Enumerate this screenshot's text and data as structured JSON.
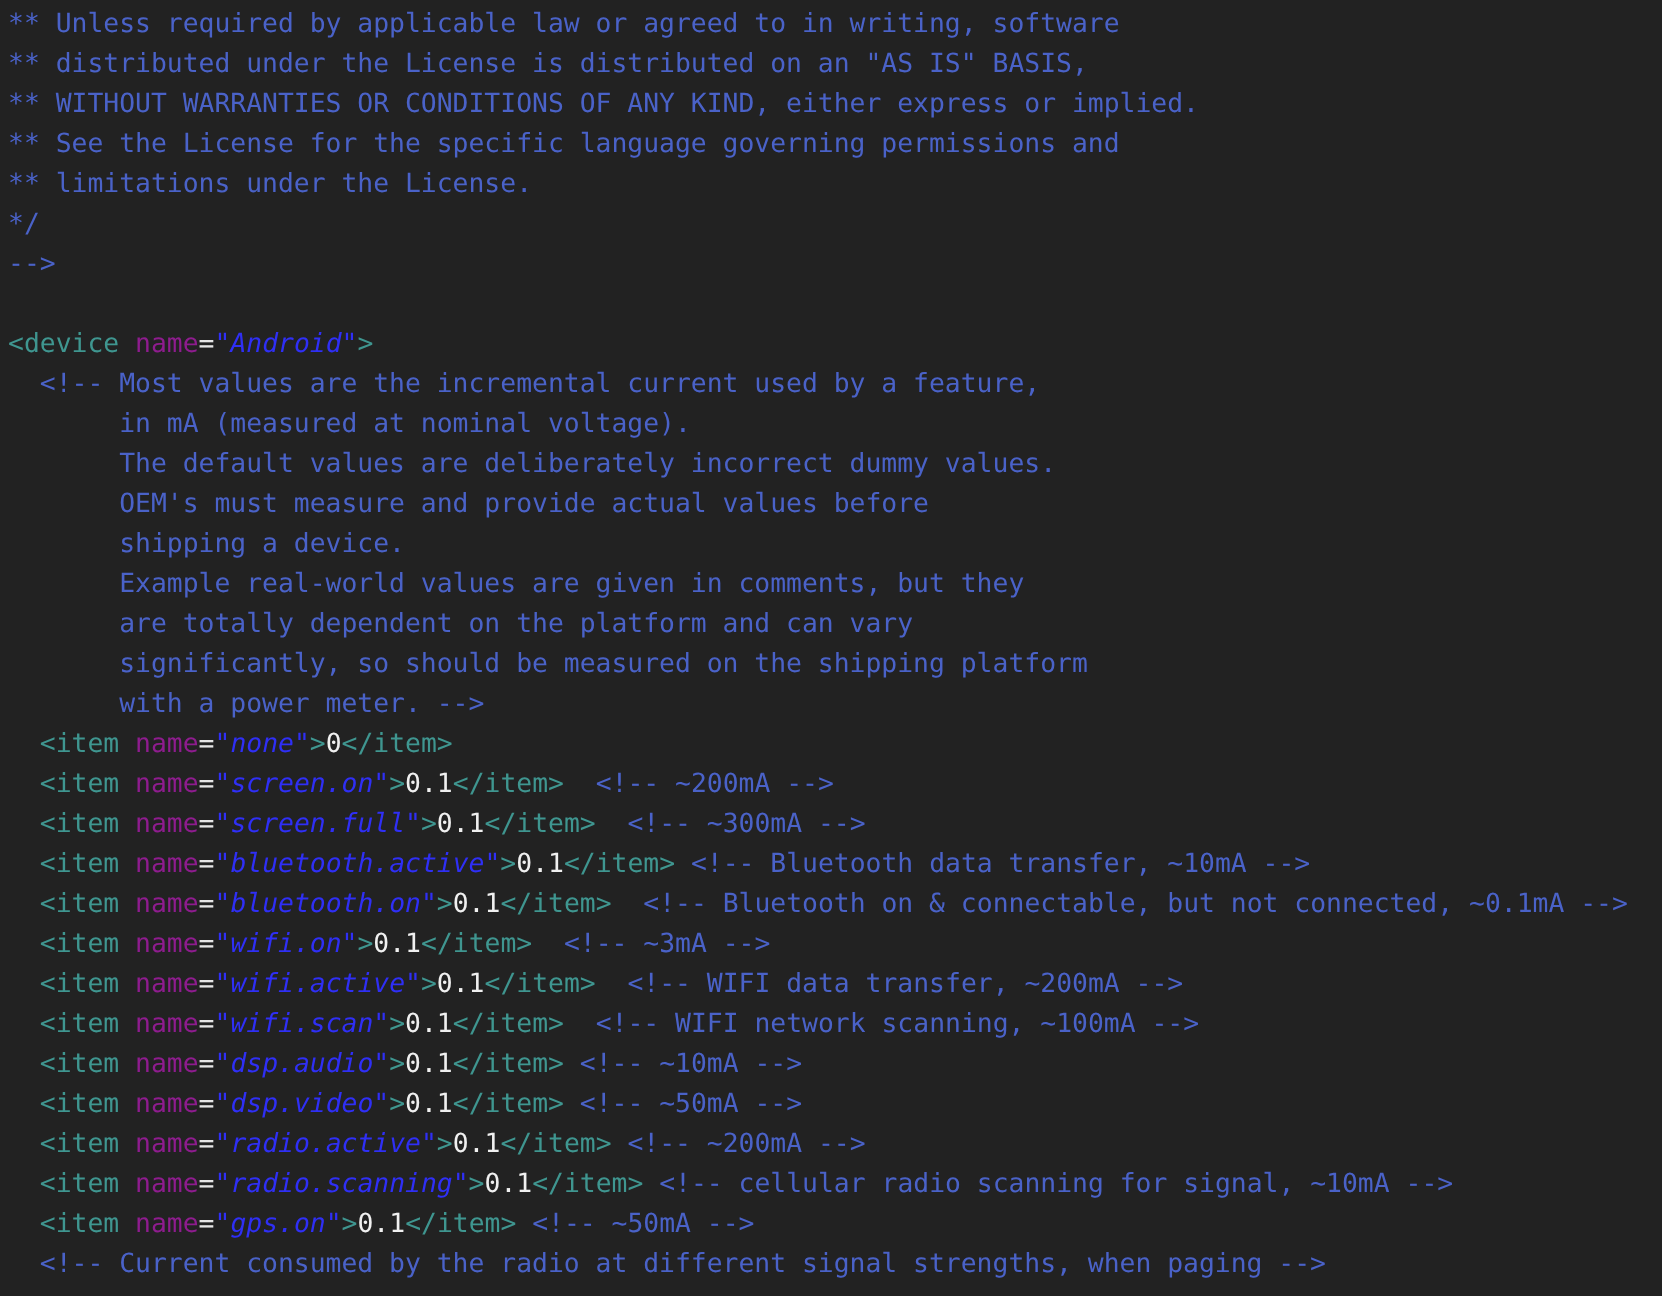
{
  "editor": {
    "lines": [
      {
        "kind": "code",
        "tokens": [
          {
            "kind": "comment",
            "text": "** Unless required by applicable law or agreed to in writing, software"
          }
        ]
      },
      {
        "kind": "code",
        "tokens": [
          {
            "kind": "comment",
            "text": "** distributed under the License is distributed on an \"AS IS\" BASIS,"
          }
        ]
      },
      {
        "kind": "code",
        "tokens": [
          {
            "kind": "comment",
            "text": "** WITHOUT WARRANTIES OR CONDITIONS OF ANY KIND, either express or implied."
          }
        ]
      },
      {
        "kind": "code",
        "tokens": [
          {
            "kind": "comment",
            "text": "** See the License for the specific language governing permissions and"
          }
        ]
      },
      {
        "kind": "code",
        "tokens": [
          {
            "kind": "comment",
            "text": "** limitations under the License."
          }
        ]
      },
      {
        "kind": "code",
        "tokens": [
          {
            "kind": "comment",
            "text": "*/"
          }
        ]
      },
      {
        "kind": "code",
        "tokens": [
          {
            "kind": "comment",
            "text": "-->"
          }
        ]
      },
      {
        "kind": "blank"
      },
      {
        "kind": "code",
        "tokens": [
          {
            "kind": "tag",
            "text": "<device "
          },
          {
            "kind": "attr",
            "text": "name"
          },
          {
            "kind": "punct",
            "text": "="
          },
          {
            "kind": "string",
            "text": "\"Android\""
          },
          {
            "kind": "tag",
            "text": ">"
          }
        ]
      },
      {
        "kind": "code",
        "tokens": [
          {
            "kind": "comment",
            "text": "  <!-- Most values are the incremental current used by a feature,"
          }
        ]
      },
      {
        "kind": "code",
        "tokens": [
          {
            "kind": "comment",
            "text": "       in mA (measured at nominal voltage)."
          }
        ]
      },
      {
        "kind": "code",
        "tokens": [
          {
            "kind": "comment",
            "text": "       The default values are deliberately incorrect dummy values."
          }
        ]
      },
      {
        "kind": "code",
        "tokens": [
          {
            "kind": "comment",
            "text": "       OEM's must measure and provide actual values before"
          }
        ]
      },
      {
        "kind": "code",
        "tokens": [
          {
            "kind": "comment",
            "text": "       shipping a device."
          }
        ]
      },
      {
        "kind": "code",
        "tokens": [
          {
            "kind": "comment",
            "text": "       Example real-world values are given in comments, but they"
          }
        ]
      },
      {
        "kind": "code",
        "tokens": [
          {
            "kind": "comment",
            "text": "       are totally dependent on the platform and can vary"
          }
        ]
      },
      {
        "kind": "code",
        "tokens": [
          {
            "kind": "comment",
            "text": "       significantly, so should be measured on the shipping platform"
          }
        ]
      },
      {
        "kind": "code",
        "tokens": [
          {
            "kind": "comment",
            "text": "       with a power meter. -->"
          }
        ]
      },
      {
        "kind": "code",
        "tokens": [
          {
            "kind": "tag",
            "text": "  <item "
          },
          {
            "kind": "attr",
            "text": "name"
          },
          {
            "kind": "punct",
            "text": "="
          },
          {
            "kind": "string",
            "text": "\"none\""
          },
          {
            "kind": "tag",
            "text": ">"
          },
          {
            "kind": "text",
            "text": "0"
          },
          {
            "kind": "tag",
            "text": "</item>"
          }
        ]
      },
      {
        "kind": "code",
        "tokens": [
          {
            "kind": "tag",
            "text": "  <item "
          },
          {
            "kind": "attr",
            "text": "name"
          },
          {
            "kind": "punct",
            "text": "="
          },
          {
            "kind": "string",
            "text": "\"screen.on\""
          },
          {
            "kind": "tag",
            "text": ">"
          },
          {
            "kind": "text",
            "text": "0.1"
          },
          {
            "kind": "tag",
            "text": "</item>"
          },
          {
            "kind": "comment",
            "text": "  <!-- ~200mA -->"
          }
        ]
      },
      {
        "kind": "code",
        "tokens": [
          {
            "kind": "tag",
            "text": "  <item "
          },
          {
            "kind": "attr",
            "text": "name"
          },
          {
            "kind": "punct",
            "text": "="
          },
          {
            "kind": "string",
            "text": "\"screen.full\""
          },
          {
            "kind": "tag",
            "text": ">"
          },
          {
            "kind": "text",
            "text": "0.1"
          },
          {
            "kind": "tag",
            "text": "</item>"
          },
          {
            "kind": "comment",
            "text": "  <!-- ~300mA -->"
          }
        ]
      },
      {
        "kind": "code",
        "tokens": [
          {
            "kind": "tag",
            "text": "  <item "
          },
          {
            "kind": "attr",
            "text": "name"
          },
          {
            "kind": "punct",
            "text": "="
          },
          {
            "kind": "string",
            "text": "\"bluetooth.active\""
          },
          {
            "kind": "tag",
            "text": ">"
          },
          {
            "kind": "text",
            "text": "0.1"
          },
          {
            "kind": "tag",
            "text": "</item>"
          },
          {
            "kind": "comment",
            "text": " <!-- Bluetooth data transfer, ~10mA -->"
          }
        ]
      },
      {
        "kind": "code",
        "tokens": [
          {
            "kind": "tag",
            "text": "  <item "
          },
          {
            "kind": "attr",
            "text": "name"
          },
          {
            "kind": "punct",
            "text": "="
          },
          {
            "kind": "string",
            "text": "\"bluetooth.on\""
          },
          {
            "kind": "tag",
            "text": ">"
          },
          {
            "kind": "text",
            "text": "0.1"
          },
          {
            "kind": "tag",
            "text": "</item>"
          },
          {
            "kind": "comment",
            "text": "  <!-- Bluetooth on & connectable, but not connected, ~0.1mA -->"
          }
        ]
      },
      {
        "kind": "code",
        "tokens": [
          {
            "kind": "tag",
            "text": "  <item "
          },
          {
            "kind": "attr",
            "text": "name"
          },
          {
            "kind": "punct",
            "text": "="
          },
          {
            "kind": "string",
            "text": "\"wifi.on\""
          },
          {
            "kind": "tag",
            "text": ">"
          },
          {
            "kind": "text",
            "text": "0.1"
          },
          {
            "kind": "tag",
            "text": "</item>"
          },
          {
            "kind": "comment",
            "text": "  <!-- ~3mA -->"
          }
        ]
      },
      {
        "kind": "code",
        "tokens": [
          {
            "kind": "tag",
            "text": "  <item "
          },
          {
            "kind": "attr",
            "text": "name"
          },
          {
            "kind": "punct",
            "text": "="
          },
          {
            "kind": "string",
            "text": "\"wifi.active\""
          },
          {
            "kind": "tag",
            "text": ">"
          },
          {
            "kind": "text",
            "text": "0.1"
          },
          {
            "kind": "tag",
            "text": "</item>"
          },
          {
            "kind": "comment",
            "text": "  <!-- WIFI data transfer, ~200mA -->"
          }
        ]
      },
      {
        "kind": "code",
        "tokens": [
          {
            "kind": "tag",
            "text": "  <item "
          },
          {
            "kind": "attr",
            "text": "name"
          },
          {
            "kind": "punct",
            "text": "="
          },
          {
            "kind": "string",
            "text": "\"wifi.scan\""
          },
          {
            "kind": "tag",
            "text": ">"
          },
          {
            "kind": "text",
            "text": "0.1"
          },
          {
            "kind": "tag",
            "text": "</item>"
          },
          {
            "kind": "comment",
            "text": "  <!-- WIFI network scanning, ~100mA -->"
          }
        ]
      },
      {
        "kind": "code",
        "tokens": [
          {
            "kind": "tag",
            "text": "  <item "
          },
          {
            "kind": "attr",
            "text": "name"
          },
          {
            "kind": "punct",
            "text": "="
          },
          {
            "kind": "string",
            "text": "\"dsp.audio\""
          },
          {
            "kind": "tag",
            "text": ">"
          },
          {
            "kind": "text",
            "text": "0.1"
          },
          {
            "kind": "tag",
            "text": "</item>"
          },
          {
            "kind": "comment",
            "text": " <!-- ~10mA -->"
          }
        ]
      },
      {
        "kind": "code",
        "tokens": [
          {
            "kind": "tag",
            "text": "  <item "
          },
          {
            "kind": "attr",
            "text": "name"
          },
          {
            "kind": "punct",
            "text": "="
          },
          {
            "kind": "string",
            "text": "\"dsp.video\""
          },
          {
            "kind": "tag",
            "text": ">"
          },
          {
            "kind": "text",
            "text": "0.1"
          },
          {
            "kind": "tag",
            "text": "</item>"
          },
          {
            "kind": "comment",
            "text": " <!-- ~50mA -->"
          }
        ]
      },
      {
        "kind": "code",
        "tokens": [
          {
            "kind": "tag",
            "text": "  <item "
          },
          {
            "kind": "attr",
            "text": "name"
          },
          {
            "kind": "punct",
            "text": "="
          },
          {
            "kind": "string",
            "text": "\"radio.active\""
          },
          {
            "kind": "tag",
            "text": ">"
          },
          {
            "kind": "text",
            "text": "0.1"
          },
          {
            "kind": "tag",
            "text": "</item>"
          },
          {
            "kind": "comment",
            "text": " <!-- ~200mA -->"
          }
        ]
      },
      {
        "kind": "code",
        "tokens": [
          {
            "kind": "tag",
            "text": "  <item "
          },
          {
            "kind": "attr",
            "text": "name"
          },
          {
            "kind": "punct",
            "text": "="
          },
          {
            "kind": "string",
            "text": "\"radio.scanning\""
          },
          {
            "kind": "tag",
            "text": ">"
          },
          {
            "kind": "text",
            "text": "0.1"
          },
          {
            "kind": "tag",
            "text": "</item>"
          },
          {
            "kind": "comment",
            "text": " <!-- cellular radio scanning for signal, ~10mA -->"
          }
        ]
      },
      {
        "kind": "code",
        "tokens": [
          {
            "kind": "tag",
            "text": "  <item "
          },
          {
            "kind": "attr",
            "text": "name"
          },
          {
            "kind": "punct",
            "text": "="
          },
          {
            "kind": "string",
            "text": "\"gps.on\""
          },
          {
            "kind": "tag",
            "text": ">"
          },
          {
            "kind": "text",
            "text": "0.1"
          },
          {
            "kind": "tag",
            "text": "</item>"
          },
          {
            "kind": "comment",
            "text": " <!-- ~50mA -->"
          }
        ]
      },
      {
        "kind": "code",
        "tokens": [
          {
            "kind": "comment",
            "text": "  <!-- Current consumed by the radio at different signal strengths, when paging -->"
          }
        ]
      }
    ]
  }
}
